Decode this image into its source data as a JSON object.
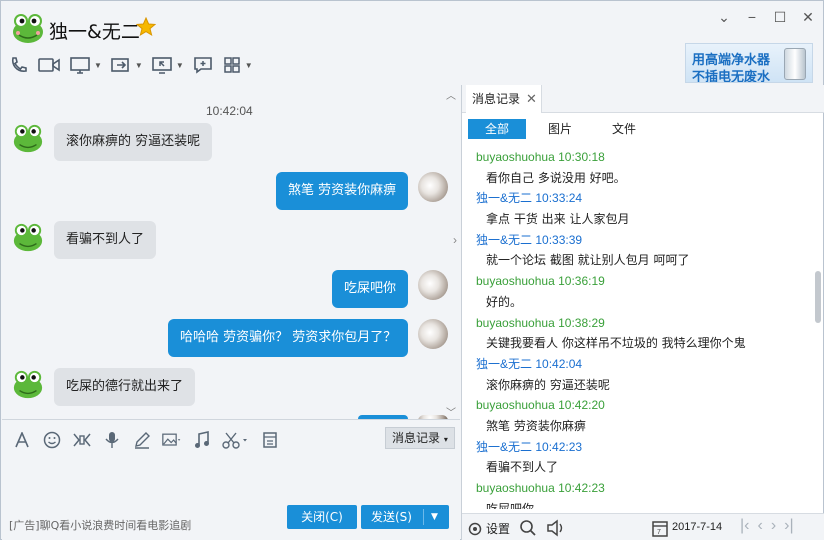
{
  "header": {
    "title": "独一&无二"
  },
  "ad": {
    "line1": "用高端净水器",
    "line2": "不插电无废水"
  },
  "chat": {
    "time": "10:42:04",
    "messages": [
      {
        "side": "left",
        "text": "滚你麻痹的   穷逼还装呢"
      },
      {
        "side": "right",
        "text": "煞笔 劳资装你麻痹"
      },
      {
        "side": "left",
        "text": "看骗不到人了"
      },
      {
        "side": "right",
        "text": "吃屎吧你"
      },
      {
        "side": "right",
        "text": "哈哈哈 劳资骗你？ 劳资求你包月了？"
      },
      {
        "side": "left",
        "text": "吃屎的德行就出来了"
      }
    ]
  },
  "input": {
    "history_label": "消息记录",
    "ad_text": "[广告]聊Q看小说浪费时间看电影追剧",
    "close_label": "关闭(C)",
    "send_label": "发送(S)"
  },
  "panel": {
    "tab_label": "消息记录",
    "filters": [
      "全部",
      "图片",
      "文件"
    ],
    "records": [
      {
        "who": "buyaoshuohua",
        "time": "10:30:18",
        "text": "看你自己 多说没用  好吧。",
        "color": "g"
      },
      {
        "who": "独一&无二",
        "time": "10:33:24",
        "text": "拿点 干货 出来  让人家包月",
        "color": "b"
      },
      {
        "who": "独一&无二",
        "time": "10:33:39",
        "text": "就一个论坛 截图  就让别人包月    呵呵了",
        "color": "b"
      },
      {
        "who": "buyaoshuohua",
        "time": "10:36:19",
        "text": "好的。",
        "color": "g"
      },
      {
        "who": "buyaoshuohua",
        "time": "10:38:29",
        "text": "关键我要看人  你这样吊不垃圾的 我特么理你个鬼",
        "color": "g"
      },
      {
        "who": "独一&无二",
        "time": "10:42:04",
        "text": "滚你麻痹的    穷逼还装呢",
        "color": "b"
      },
      {
        "who": "buyaoshuohua",
        "time": "10:42:20",
        "text": "煞笔 劳资装你麻痹",
        "color": "g"
      },
      {
        "who": "独一&无二",
        "time": "10:42:23",
        "text": "看骗不到人了",
        "color": "b"
      },
      {
        "who": "buyaoshuohua",
        "time": "10:42:23",
        "text": "吃屎吧你",
        "color": "g"
      }
    ],
    "footer": {
      "settings_label": "设置",
      "date": "2017-7-14"
    }
  }
}
